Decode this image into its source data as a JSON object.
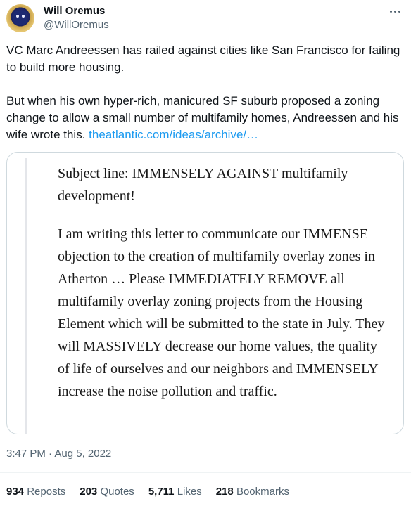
{
  "author": {
    "display_name": "Will Oremus",
    "handle": "@WillOremus",
    "avatar_icon": "avatar-image"
  },
  "more_icon": "more-options-icon",
  "tweet": {
    "paragraph1": "VC Marc Andreessen has railed against cities like San Francisco for failing to build more housing.",
    "paragraph2": "But when his own hyper-rich, manicured SF suburb proposed a zoning change to allow a small number of multifamily homes, Andreessen and his wife wrote this.",
    "link": "theatlantic.com/ideas/archive/…"
  },
  "card": {
    "subject": "Subject line: IMMENSELY AGAINST multifamily development!",
    "body": "I am writing this letter to communicate our IMMENSE objection to the creation of multifamily overlay zones in Atherton … Please IMMEDIATELY REMOVE all multifamily overlay zoning projects from the Housing Element which will be submitted to the state in July. They will MASSIVELY decrease our home values, the quality of life of ourselves and our neighbors and IMMENSELY increase the noise pollution and traffic."
  },
  "timestamp": "3:47 PM · Aug 5, 2022",
  "stats": {
    "reposts_count": "934",
    "reposts_label": "Reposts",
    "quotes_count": "203",
    "quotes_label": "Quotes",
    "likes_count": "5,711",
    "likes_label": "Likes",
    "bookmarks_count": "218",
    "bookmarks_label": "Bookmarks"
  },
  "colors": {
    "link": "#1d9bf0",
    "secondary_text": "#536471",
    "border": "#cfd9de"
  }
}
